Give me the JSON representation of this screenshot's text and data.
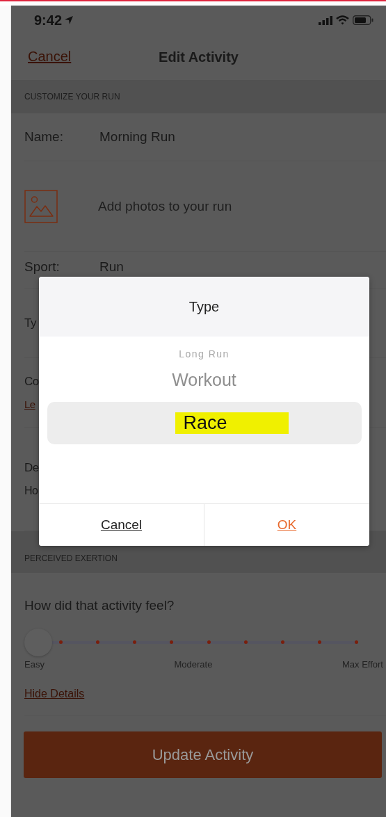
{
  "status_bar": {
    "time": "9:42"
  },
  "nav": {
    "cancel": "Cancel",
    "title": "Edit Activity"
  },
  "customize_section": {
    "header": "CUSTOMIZE YOUR RUN",
    "rows": [
      {
        "kind": "field",
        "label": "Name:",
        "value": "Morning Run"
      },
      {
        "kind": "photo",
        "text": "Add photos to your run"
      },
      {
        "kind": "field",
        "label": "Sport:",
        "value": "Run"
      },
      {
        "kind": "stacked",
        "label": "Ty"
      },
      {
        "kind": "stacked",
        "label": "Co",
        "detail": "Le",
        "detail_link": true
      },
      {
        "kind": "stacked",
        "label": "De",
        "detail": "Ho",
        "detail_link": false
      }
    ]
  },
  "exertion_section": {
    "header": "PERCEIVED EXERTION",
    "question": "How did that activity feel?",
    "slider": {
      "level": 0
    },
    "scale_labels": [
      "Easy",
      "Moderate",
      "Max Effort"
    ],
    "hide_details": "Hide Details"
  },
  "update_button": "Update Activity",
  "type_dialog": {
    "title": "Type",
    "options": [
      {
        "label": "Long Run",
        "selected": false,
        "highlighted": false
      },
      {
        "label": "Workout",
        "selected": false,
        "highlighted": false
      },
      {
        "label": "Race",
        "selected": true,
        "highlighted": true
      }
    ],
    "cancel": "Cancel",
    "ok": "OK"
  }
}
